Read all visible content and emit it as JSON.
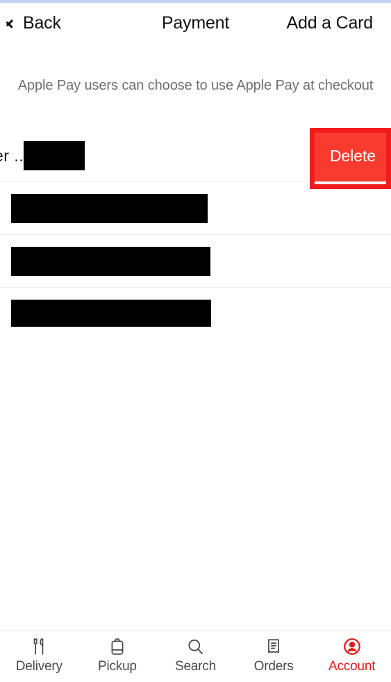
{
  "colors": {
    "accent_red": "#e01a1a",
    "delete_red": "#f93b2f",
    "annotation_red": "#f21b1b",
    "text_primary": "#111111",
    "text_muted": "#6e6e73",
    "separator": "#ededf0",
    "top_strip": "#c3d2f4"
  },
  "header": {
    "back_label": "Back",
    "back_icon": "chevron-left-icon",
    "title": "Payment",
    "action_label": "Add a Card"
  },
  "notice": {
    "text": "Apple Pay users can choose to use Apple Pay at checkout"
  },
  "card_list": {
    "rows": [
      {
        "id": "card-row-1",
        "state": "swiped-open",
        "visible_text": "er ..",
        "redacted": true,
        "action_label": "Delete"
      },
      {
        "id": "card-row-2",
        "state": "default",
        "visible_text": "",
        "redacted": true
      },
      {
        "id": "card-row-3",
        "state": "default",
        "visible_text": "",
        "redacted": true
      },
      {
        "id": "card-row-4",
        "state": "default",
        "visible_text": "",
        "redacted": true
      }
    ]
  },
  "annotation": {
    "target": "delete-button",
    "shape": "rectangle-outline"
  },
  "tab_bar": {
    "items": [
      {
        "label": "Delivery",
        "icon": "utensils-icon",
        "active": false
      },
      {
        "label": "Pickup",
        "icon": "bag-icon",
        "active": false
      },
      {
        "label": "Search",
        "icon": "search-icon",
        "active": false
      },
      {
        "label": "Orders",
        "icon": "receipt-icon",
        "active": false
      },
      {
        "label": "Account",
        "icon": "user-circle-icon",
        "active": true
      }
    ]
  }
}
